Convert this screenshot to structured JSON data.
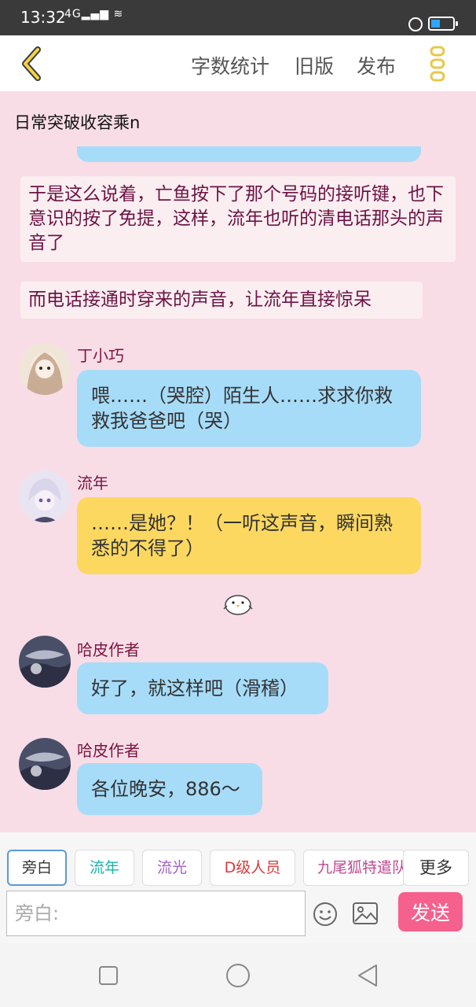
{
  "status_bar": {
    "time": "13:32",
    "signal": "4G",
    "accent": "#2fa4ff"
  },
  "toolbar": {
    "word_count": "字数统计",
    "old_version": "旧版",
    "publish": "发布",
    "accent": "#f0d34a"
  },
  "story_title": "日常突破收容乘n",
  "messages": [
    {
      "type": "narration",
      "text": "于是这么说着，亡鱼按下了那个号码的接听键，也下意识的按了免提，这样，流年也听的清电话那头的声音了"
    },
    {
      "type": "narration",
      "text": "而电话接通时穿来的声音，让流年直接惊呆"
    },
    {
      "type": "chat",
      "sender": "丁小巧",
      "text": "喂……（哭腔）陌生人……求求你救救我爸爸吧（哭）",
      "color": "#a7dcf9"
    },
    {
      "type": "chat",
      "sender": "流年",
      "text": "……是她？！（一听这声音，瞬间熟悉的不得了）",
      "color": "#fcd860"
    },
    {
      "type": "sticker",
      "icon": "chick-sticker-icon"
    },
    {
      "type": "chat",
      "sender": "哈皮作者",
      "text": "好了，就这样吧（滑稽）",
      "color": "#a7dcf9"
    },
    {
      "type": "chat",
      "sender": "哈皮作者",
      "text": "各位晚安，886～",
      "color": "#a7dcf9"
    }
  ],
  "roles": [
    {
      "label": "旁白",
      "color": "#333333"
    },
    {
      "label": "流年",
      "color": "#19b3a8"
    },
    {
      "label": "流光",
      "color": "#a35fc7"
    },
    {
      "label": "D级人员",
      "color": "#d93a3a"
    },
    {
      "label": "九尾狐特遣队",
      "color": "#c24a93"
    }
  ],
  "more_label": "更多",
  "composer": {
    "placeholder": "旁白:",
    "send_label": "发送",
    "send_color": "#f6608d"
  }
}
